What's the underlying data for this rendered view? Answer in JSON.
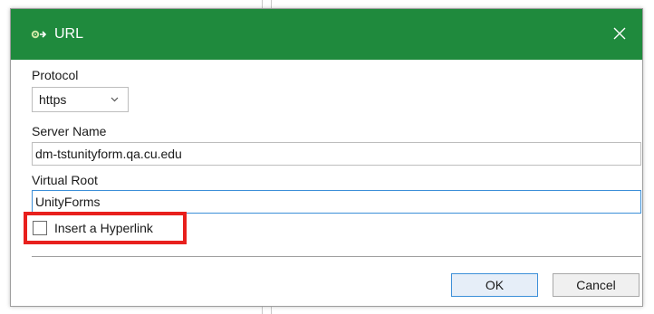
{
  "window": {
    "title": "URL",
    "title_icon": "gear-arrow-icon",
    "close_icon": "close-icon",
    "titlebar_color": "#1f8a3d"
  },
  "form": {
    "protocol": {
      "label": "Protocol",
      "selected": "https"
    },
    "server_name": {
      "label": "Server Name",
      "value": "dm-tstunityform.qa.cu.edu"
    },
    "virtual_root": {
      "label": "Virtual Root",
      "value": "UnityForms"
    },
    "hyperlink": {
      "label": "Insert a Hyperlink",
      "checked": false
    }
  },
  "buttons": {
    "ok": "OK",
    "cancel": "Cancel"
  },
  "annotation": {
    "highlight_color": "#e8201d"
  }
}
